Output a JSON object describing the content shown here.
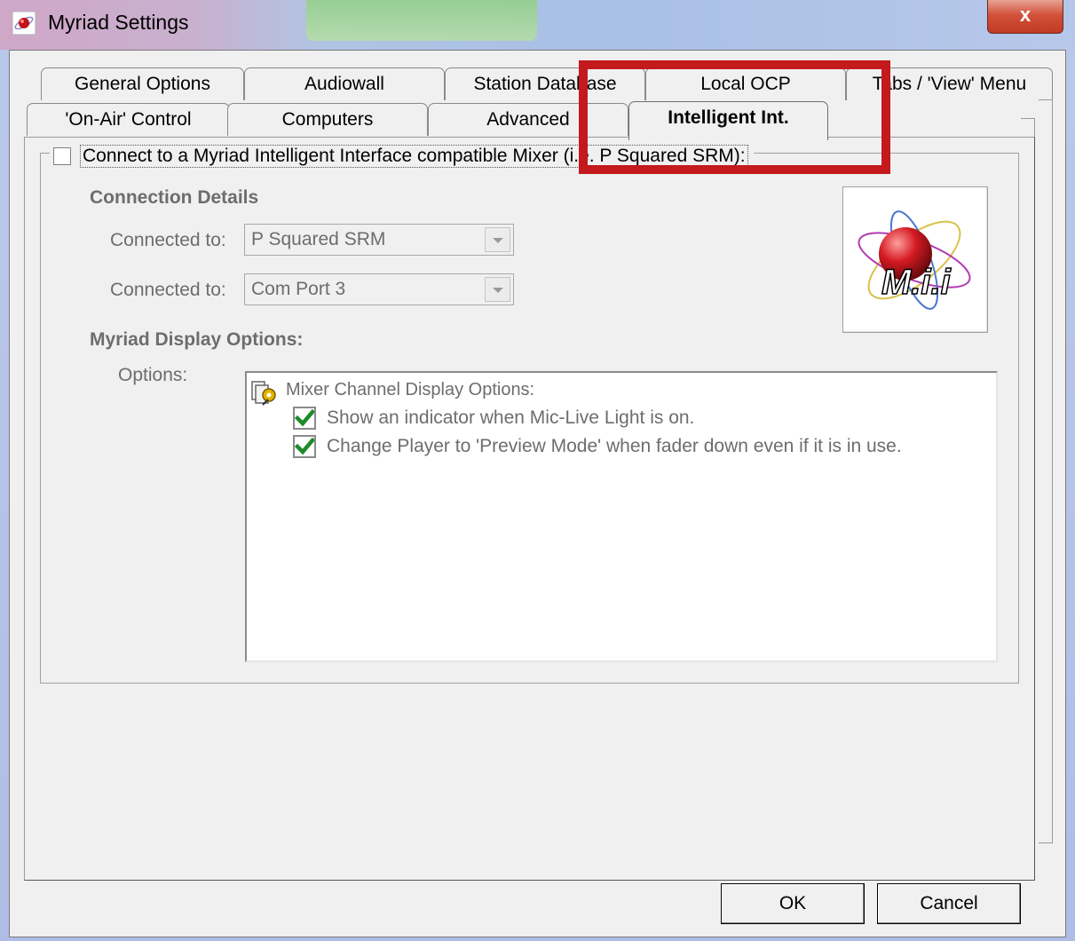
{
  "window": {
    "title": "Myriad Settings",
    "close_glyph": "x"
  },
  "tabs": {
    "row_back": [
      "General Options",
      "Audiowall",
      "Station Database",
      "Local OCP",
      "Tabs / 'View' Menu"
    ],
    "row_front": [
      "'On-Air' Control",
      "Computers",
      "Advanced",
      "Intelligent Int."
    ],
    "active": "Intelligent Int."
  },
  "panel": {
    "enable_checkbox": {
      "label": "Connect to a Myriad Intelligent Interface compatible Mixer (i.e. P Squared SRM):",
      "checked": false
    },
    "connection_heading": "Connection Details",
    "connected_label_1": "Connected to:",
    "connected_value_1": "P Squared SRM",
    "connected_label_2": "Connected to:",
    "connected_value_2": "Com Port 3",
    "display_heading": "Myriad Display Options:",
    "options_label": "Options:",
    "logo_text": "M.i.i",
    "tree": {
      "root_label": "Mixer Channel Display Options:",
      "items": [
        {
          "label": "Show an indicator when Mic-Live Light is on.",
          "checked": true
        },
        {
          "label": "Change Player to 'Preview Mode' when fader down even if it is in use.",
          "checked": true
        }
      ]
    }
  },
  "buttons": {
    "ok": "OK",
    "cancel": "Cancel"
  },
  "annotation": {
    "highlight_color": "#c41a1d"
  }
}
